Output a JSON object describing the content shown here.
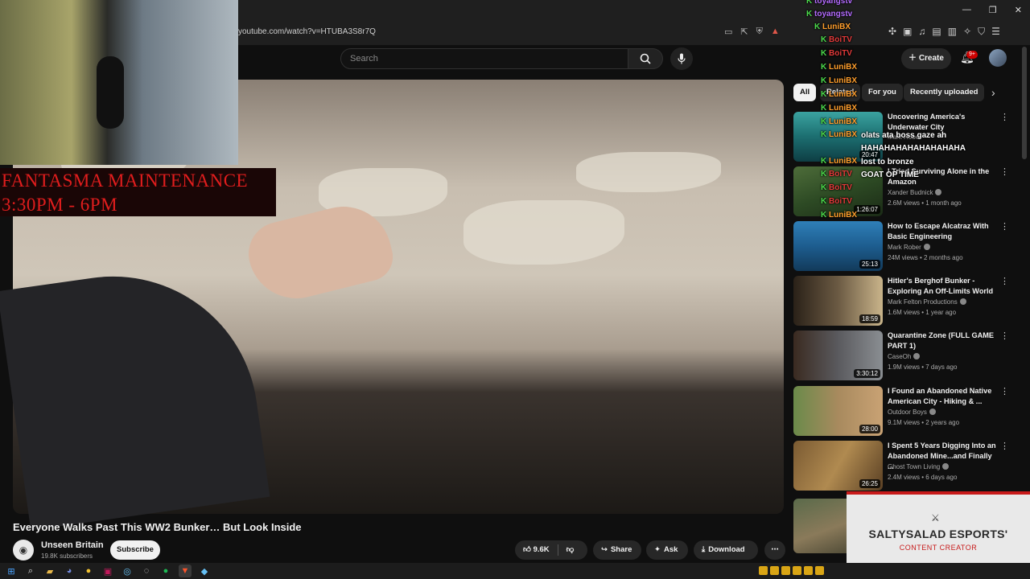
{
  "browser": {
    "url": "youtube.com/watch?v=HTUBA3S8r7Q",
    "window_controls": [
      "—",
      "❐",
      "✕"
    ]
  },
  "header": {
    "search_placeholder": "Search",
    "create_label": "Create",
    "notification_count": "9+"
  },
  "stream_overlay": {
    "title_line1": "FANTASMA MAINTENANCE",
    "title_line2": "3:30PM - 6PM"
  },
  "video": {
    "title": "Everyone Walks Past This WW2 Bunker… But Look Inside",
    "channel": "Unseen Britain",
    "subscribers": "19.8K subscribers",
    "subscribe_label": "Subscribe",
    "likes": "9.6K",
    "share_label": "Share",
    "ask_label": "Ask",
    "download_label": "Download"
  },
  "chips": [
    {
      "label": "All",
      "active": true
    },
    {
      "label": "Related",
      "active": false
    },
    {
      "label": "For you",
      "active": false
    },
    {
      "label": "Recently uploaded",
      "active": false
    }
  ],
  "recommendations": [
    {
      "title": "Uncovering America's Underwater City",
      "channel": "Mark Rober",
      "meta": "",
      "duration": "20:47"
    },
    {
      "title": "I Tried Surviving Alone in the Amazon",
      "channel": "Xander Budnick",
      "meta": "2.6M views • 1 month ago",
      "duration": "1:26:07"
    },
    {
      "title": "How to Escape Alcatraz With Basic Engineering",
      "channel": "Mark Rober",
      "meta": "24M views • 2 months ago",
      "duration": "25:13"
    },
    {
      "title": "Hitler's Berghof Bunker - Exploring An Off-Limits World",
      "channel": "Mark Felton Productions",
      "meta": "1.6M views • 1 year ago",
      "duration": "18:59"
    },
    {
      "title": "Quarantine Zone (FULL GAME PART 1)",
      "channel": "CaseOh",
      "meta": "1.9M views • 7 days ago",
      "duration": "3:30:12"
    },
    {
      "title": "I Found an Abandoned Native American City - Hiking & ...",
      "channel": "Outdoor Boys",
      "meta": "9.1M views • 2 years ago",
      "duration": "28:00"
    },
    {
      "title": "I Spent 5 Years Digging Into an Abandoned Mine...and Finally ...",
      "channel": "Ghost Town Living",
      "meta": "2.4M views • 6 days ago",
      "duration": "26:25"
    }
  ],
  "chat": {
    "users": [
      "toyangstv",
      "toyangstv",
      "LuniBX",
      "BoiTV",
      "BoiTV",
      "LuniBX",
      "LuniBX",
      "LuniBX",
      "LuniBX",
      "LuniBX",
      "LuniBX",
      "LuniBX",
      "BoiTV",
      "BoiTV",
      "BoiTV",
      "LuniBX"
    ],
    "messages": [
      "olats ata boss gaze ah",
      "HAHAHAHAHAHAHAHAHA",
      "lost to bronze",
      "GOAT OP TIME"
    ]
  },
  "sponsor": {
    "name": "SALTYSALAD ESPORTS'",
    "subtitle": "CONTENT CREATOR"
  },
  "colors": {
    "accent_red": "#cc0000",
    "chat_green": "#4cdd4c",
    "overlay_red": "#e01d1d"
  }
}
